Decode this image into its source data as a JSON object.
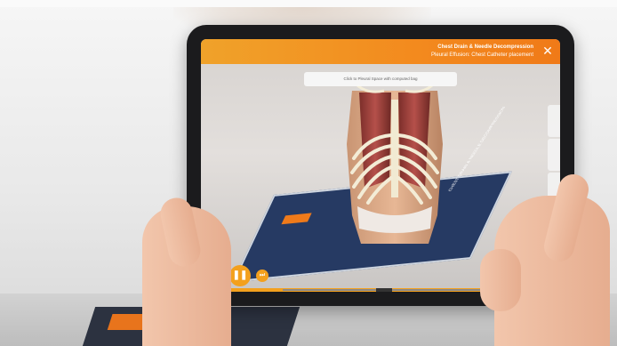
{
  "app": {
    "header_title": "Chest Drain & Needle Decompression",
    "header_subtitle": "Pleural Effusion: Chest Catheter placement",
    "close_label": "✕"
  },
  "scene": {
    "instruction_text": "Click to Pleural Space with computed bag",
    "card_text": "CHEST DRAIN & NEEDLE DECOMPRESSION",
    "model_icon": "anatomical-torso-model"
  },
  "controls": {
    "prev_label": "⏮",
    "play_label": "❚❚",
    "next_label": "⏭",
    "timeline_progress": 0.38
  },
  "colors": {
    "accent": "#f3a01d",
    "header_start": "#f0a22a",
    "header_end": "#f07a18",
    "card_blue": "#263a63"
  }
}
